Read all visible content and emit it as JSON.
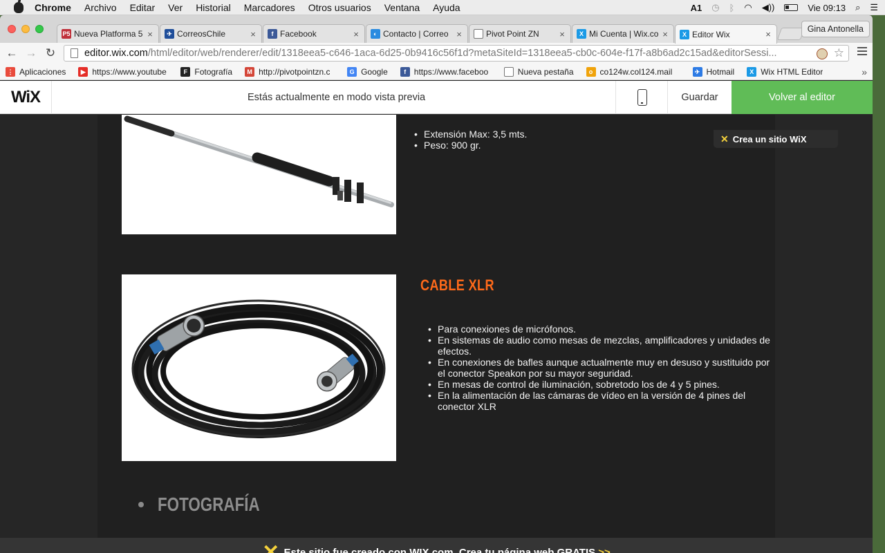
{
  "menubar": {
    "app": "Chrome",
    "items": [
      "Archivo",
      "Editar",
      "Ver",
      "Historial",
      "Marcadores",
      "Otros usuarios",
      "Ventana",
      "Ayuda"
    ],
    "adobe_count": "1",
    "clock": "Vie 09:13"
  },
  "tabs": [
    {
      "title": "Nueva Platforma 5",
      "icon": "p5-favicon",
      "color": "#c0303a",
      "glyph": "P5"
    },
    {
      "title": "CorreosChile",
      "icon": "correos-favicon",
      "color": "#1f4e9a",
      "glyph": "✈"
    },
    {
      "title": "Facebook",
      "icon": "facebook-favicon",
      "color": "#3b5998",
      "glyph": "f"
    },
    {
      "title": "Contacto | Correo",
      "icon": "correo-favicon",
      "color": "#2a8be0",
      "glyph": "◐"
    },
    {
      "title": "Pivot Point ZN",
      "icon": "page-favicon",
      "color": "#ffffff",
      "glyph": ""
    },
    {
      "title": "Mi Cuenta | Wix.co",
      "icon": "wix-favicon",
      "color": "#1b9ae6",
      "glyph": "X"
    },
    {
      "title": "Editor Wix",
      "icon": "wix-favicon",
      "color": "#1b9ae6",
      "glyph": "X"
    }
  ],
  "profile": "Gina Antonella",
  "url": {
    "host": "editor.wix.com",
    "path": "/html/editor/web/renderer/edit/1318eea5-c646-1aca-6d25-0b9416c56f1d?metaSiteId=1318eea5-cb0c-604e-f17f-a8b6ad2c15ad&editorSessi..."
  },
  "bookmarks": [
    {
      "label": "Aplicaciones",
      "icon": "apps-grid-icon",
      "color": "#e94b3c",
      "glyph": "⋮"
    },
    {
      "label": "https://www.youtube",
      "icon": "youtube-icon",
      "color": "#e52d27",
      "glyph": "▶"
    },
    {
      "label": "Fotografía",
      "icon": "fotografia-icon",
      "color": "#222222",
      "glyph": "F"
    },
    {
      "label": "http://pivotpointzn.c",
      "icon": "gmail-icon",
      "color": "#d44638",
      "glyph": "M"
    },
    {
      "label": "Google",
      "icon": "google-icon",
      "color": "#4285f4",
      "glyph": "G"
    },
    {
      "label": "https://www.faceboo",
      "icon": "facebook-icon",
      "color": "#3b5998",
      "glyph": "f"
    },
    {
      "label": "Nueva pestaña",
      "icon": "page-icon",
      "color": "#ffffff",
      "glyph": ""
    },
    {
      "label": "co124w.col124.mail",
      "icon": "outlook-icon",
      "color": "#f0a30a",
      "glyph": "o"
    },
    {
      "label": "Hotmail",
      "icon": "hotmail-icon",
      "color": "#2d7be5",
      "glyph": "✈"
    },
    {
      "label": "Wix HTML Editor",
      "icon": "wix-icon",
      "color": "#1b9ae6",
      "glyph": "X"
    }
  ],
  "wixbar": {
    "logo": "WiX",
    "preview_message": "Estás actualmente en modo vista previa",
    "save_label": "Guardar",
    "back_label": "Volver al editor"
  },
  "page": {
    "pole_specs": [
      "Extensión Max: 3,5 mts.",
      "Peso: 900 gr."
    ],
    "crea_badge": "Crea un sitio WiX",
    "xlr_title": "CABLE XLR",
    "xlr_items": [
      "Para conexiones de micrófonos.",
      "En sistemas de audio como mesas de mezclas, amplificadores y unidades de efectos.",
      "En conexiones de bafles aunque actualmente muy en desuso y sustituido por el conector Speakon por su mayor seguridad.",
      "En mesas de control de iluminación, sobretodo los de 4 y 5 pines.",
      "En la alimentación de las cámaras de vídeo en la versión de 4 pines del conector XLR"
    ],
    "section_heading": "FOTOGRAFÍA",
    "ad_text": "Este sitio fue creado con WIX.com. Crea tu página web GRATIS",
    "ad_arrows": ">>"
  },
  "colors": {
    "accent_orange": "#ff6a1a",
    "wix_green": "#60bc57",
    "wix_yellow": "#f5d23c"
  }
}
